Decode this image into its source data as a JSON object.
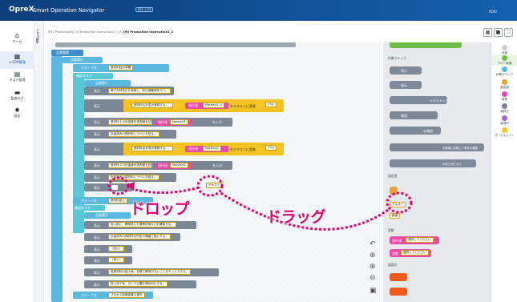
{
  "header": {
    "brand": "OpreX",
    "app_name": "Smart Operation Navigator",
    "version": "REV 1.03",
    "user": "ROSI"
  },
  "sidebar": [
    {
      "label": "ホーム",
      "icon": "home-icon"
    },
    {
      "label": "e-SOP管理",
      "icon": "sop-icon"
    },
    {
      "label": "タスク管理",
      "icon": "task-icon"
    },
    {
      "label": "監査ログ",
      "icon": "log-icon"
    },
    {
      "label": "設定",
      "icon": "gear-icon"
    }
  ],
  "collapsed_panel": "e-SOP編集",
  "breadcrumb": {
    "path": "EN / ProductionB / [f] Production Instruction2 / / [f]",
    "current": "[M] Production Instruction2_2"
  },
  "workspace": {
    "b1": "品質管理",
    "b2": "品質実行",
    "b3": "グループ名",
    "b3v": "原材料詰め準備",
    "b4": "確認タスク",
    "b5": "品質実行",
    "n": "表示",
    "r1": "電子天秤校正を実施し、校正値確認を行う。",
    "r2": "原材料名を表示登録する。",
    "r2op": "操作値",
    "r2v": "Material1_a",
    "r2x": "をテキストに変換",
    "r2t": "c%g",
    "r3": "原材料１の計量値を実測値を記録する。",
    "r3op": "操作値",
    "r3v": "Material1",
    "r3x": "を入力",
    "r4": "計量済みの原材料にラベルを貼る。",
    "r5": "原材料名を表示登録する。",
    "r5op": "操作値",
    "r5v": "Material2",
    "r5x": "をテキストに変換",
    "r5t": "c%g",
    "r6": "原材料２の計量値を実測値を記録する。",
    "r6op": "操作値",
    "r6v": "Material2",
    "r6x": "を入力",
    "r7": "計量済みの原材料にラベルを貼る。",
    "r8v": "テキスト",
    "g2": "グループ名",
    "g2v": "原材料投入",
    "g3": "確認タスク",
    "g4": "品質実行",
    "s1": "投入前に、異物混入や清掃状態などを確認する。",
    "s2": "計量済みの原材料を所定の順番で投入する。",
    "s3": "（投入）",
    "s4": "（投入）",
    "s5": "各原材料の投入後、目視で異常がないことをチェックする。",
    "s6": "投入完了後、タンクの蓋を閉め封止する。",
    "g5": "グループ名",
    "g5v": "プロセス制御装置の操作"
  },
  "palette": {
    "hdr1": "作業ステップ",
    "l1": "表示",
    "l2": "指示",
    "l3": "テキスト入力",
    "l4": "確認",
    "l5": "を確認",
    "l6": "を数値に変換して条件を確認",
    "l7": "が前と同じなら",
    "hdr2": "固定値",
    "t1": "テキスト",
    "t2": "数値",
    "hdr3": "変数",
    "v1": "操作値",
    "v1v": "選択してください",
    "v2": "変数",
    "v2v": "選択してください",
    "hdr4": "画面式"
  },
  "categories": [
    {
      "label": "待機",
      "color": "#c9ced6"
    },
    {
      "label": "フロー制御",
      "color": "#6dbf4a"
    },
    {
      "label": "作業ステップ",
      "color": "#5ab7dd"
    },
    {
      "label": "固定値",
      "color": "#e9a23b"
    },
    {
      "label": "変数",
      "color": "#e74aa8"
    },
    {
      "label": "演算式",
      "color": "#7b8794"
    },
    {
      "label": "論理式",
      "color": "#9a6bd0"
    },
    {
      "label": "式（テキスト）",
      "color": "#f5c323"
    }
  ],
  "annotations": {
    "drop": "ドロップ",
    "drag": "ドラッグ"
  }
}
